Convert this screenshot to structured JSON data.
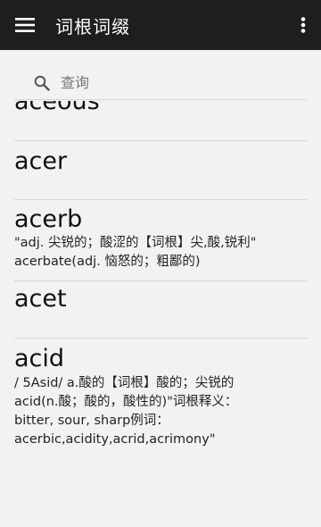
{
  "appbar": {
    "title": "词根词缀",
    "menu_icon": "menu-icon",
    "overflow_icon": "more-vert-icon"
  },
  "search": {
    "placeholder": "查询",
    "value": ""
  },
  "entries": [
    {
      "word": "aceous",
      "desc": []
    },
    {
      "word": "acer",
      "desc": []
    },
    {
      "word": "acerb",
      "desc": [
        "\"adj. 尖锐的；酸涩的【词根】尖,酸,锐利\"",
        "acerbate(adj. 恼怒的；粗鄙的)"
      ]
    },
    {
      "word": "acet",
      "desc": []
    },
    {
      "word": "acid",
      "desc": [
        "/ 5Asid/  a.酸的【词根】酸的；尖锐的",
        "acid(n.酸；酸的，酸性的)\"词根释义：",
        "bitter, sour, sharp例词：",
        "acerbic,acidity,acrid,acrimony\""
      ]
    }
  ]
}
